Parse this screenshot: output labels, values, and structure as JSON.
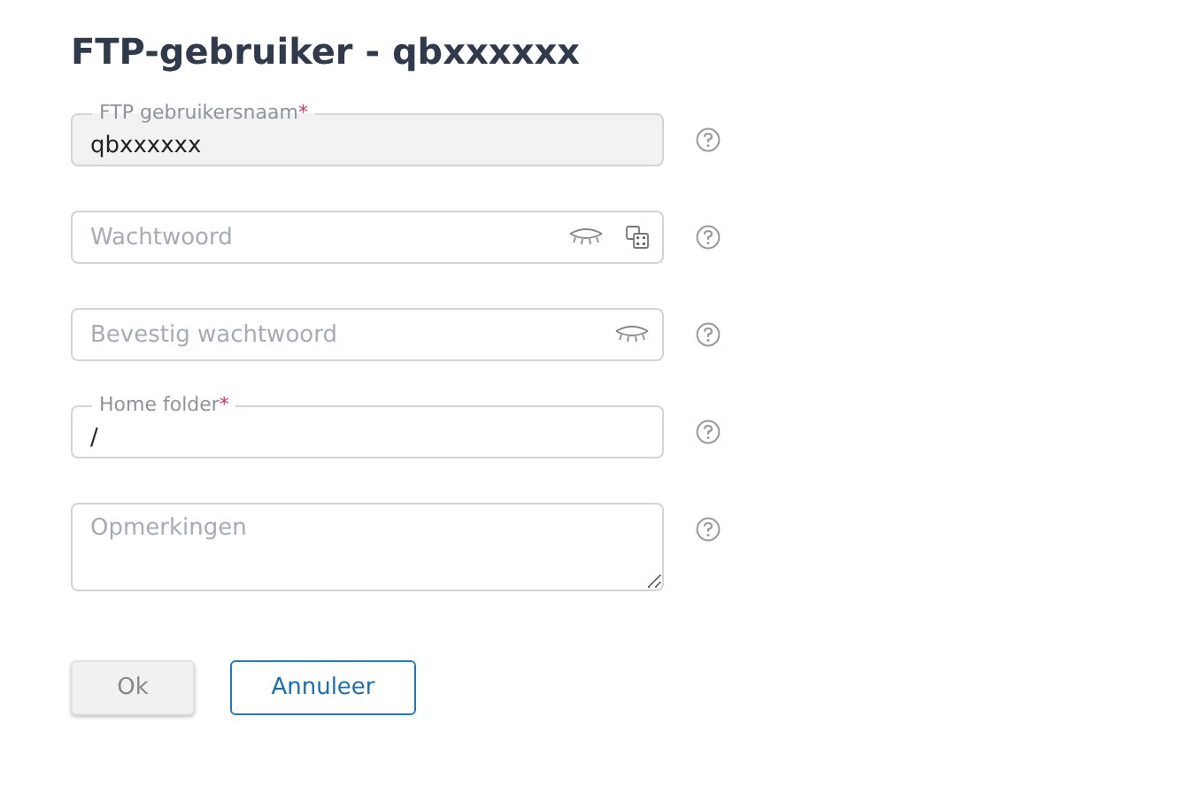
{
  "title": "FTP-gebruiker - qbxxxxxx",
  "fields": [
    {
      "kind": "text",
      "label": "FTP gebruikersnaam",
      "required_mark": "*",
      "value": "qbxxxxxx",
      "disabled": true
    },
    {
      "kind": "password",
      "placeholder": "Wachtwoord",
      "disabled": false,
      "show_toggle": true,
      "generate": true
    },
    {
      "kind": "password",
      "placeholder": "Bevestig wachtwoord",
      "disabled": false,
      "show_toggle": true,
      "generate": false
    },
    {
      "kind": "text",
      "label": "Home folder",
      "required_mark": "*",
      "value": "/",
      "disabled": false
    },
    {
      "kind": "textarea",
      "placeholder": "Opmerkingen",
      "disabled": false
    }
  ],
  "buttons": [
    {
      "label": "Ok",
      "kind": "secondary",
      "disabled": true
    },
    {
      "label": "Annuleer",
      "kind": "outline",
      "disabled": false
    }
  ]
}
